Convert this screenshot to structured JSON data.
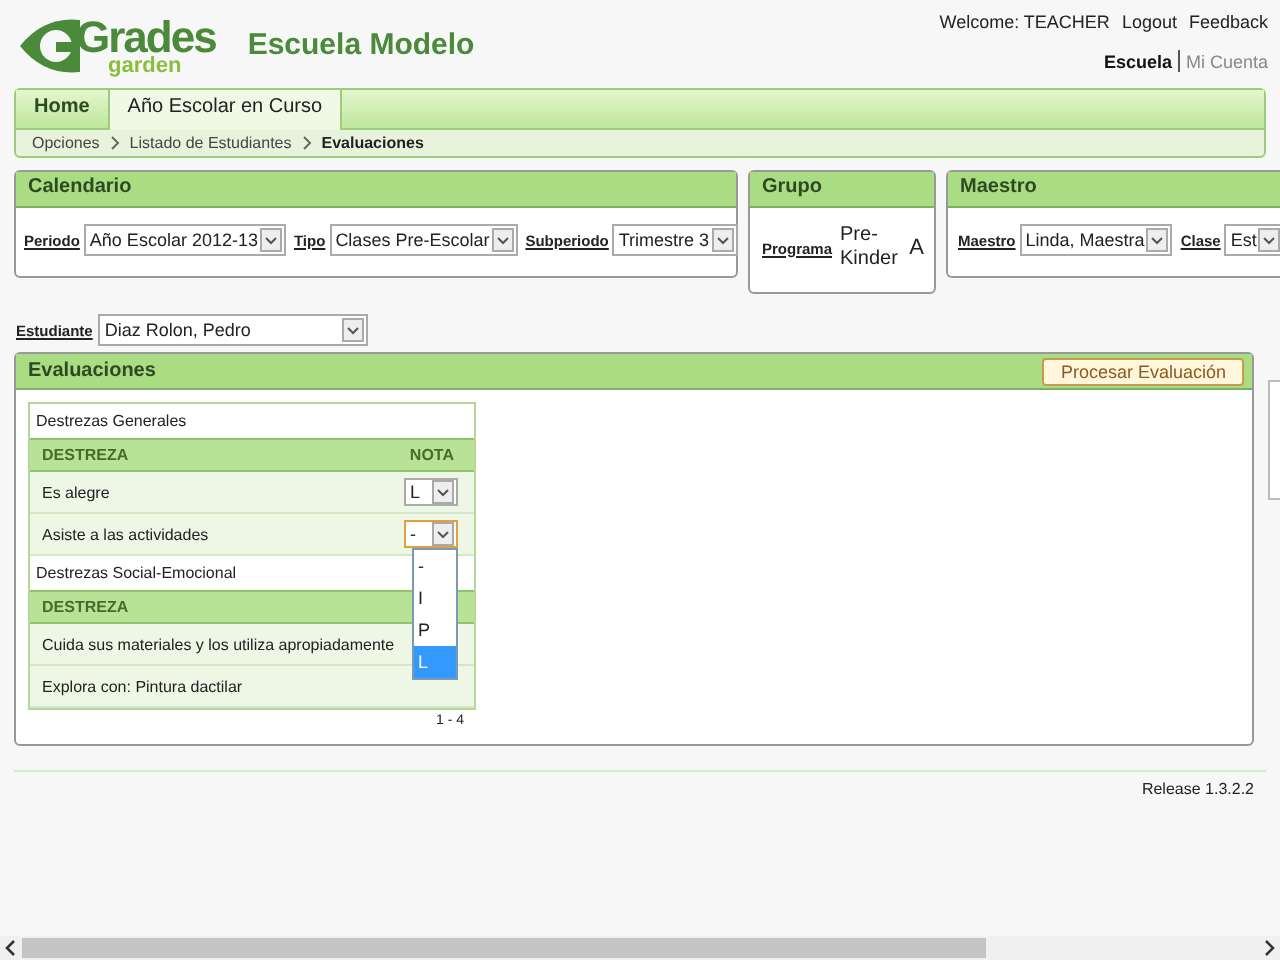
{
  "logo": {
    "word": "Grades",
    "sub": "garden"
  },
  "school": "Escuela Modelo",
  "user_links": [
    "Welcome: TEACHER",
    "Logout",
    "Feedback"
  ],
  "context": [
    {
      "label": "Escuela",
      "selected": true
    },
    {
      "label": "Mi Cuenta",
      "selected": false
    }
  ],
  "tabs": [
    {
      "label": "Home",
      "selected": false
    },
    {
      "label": "Año Escolar en Curso",
      "selected": true
    }
  ],
  "breadcrumb": [
    "Opciones",
    "Listado de Estudiantes",
    "Evaluaciones"
  ],
  "panels": [
    {
      "title": "Calendario",
      "fields": [
        {
          "label": "Periodo",
          "value": "Año Escolar 2012-13"
        },
        {
          "label": "Tipo",
          "value": "Clases Pre-Escolar"
        },
        {
          "label": "Subperiodo",
          "value": "Trimestre 3"
        }
      ]
    },
    {
      "title": "Grupo",
      "program": {
        "label": "Programa",
        "value": "Pre-Kinder",
        "group": "A"
      }
    },
    {
      "title": "Maestro",
      "fields": [
        {
          "label": "Maestro",
          "value": "Linda, Maestra"
        },
        {
          "label": "Clase",
          "value": "Est"
        }
      ]
    }
  ],
  "student": {
    "label": "Estudiante",
    "value": "Diaz Rolon, Pedro"
  },
  "evaluations": {
    "title": "Evaluaciones",
    "button": "Procesar Evaluación",
    "sections": [
      {
        "name": "Destrezas Generales",
        "col_skill": "DESTREZA",
        "col_grade": "NOTA",
        "rows": [
          {
            "skill": "Es alegre",
            "grade": "L",
            "focused": false
          },
          {
            "skill": "Asiste a las actividades",
            "grade": "-",
            "focused": true
          }
        ]
      },
      {
        "name": "Destrezas Social-Emocional",
        "col_skill": "DESTREZA",
        "rows": [
          {
            "skill": "Cuida sus materiales y los utiliza apropiadamente"
          },
          {
            "skill": "Explora con: Pintura dactilar"
          }
        ]
      }
    ],
    "dropdown": [
      {
        "label": "-",
        "selected": false
      },
      {
        "label": "I",
        "selected": false
      },
      {
        "label": "P",
        "selected": false
      },
      {
        "label": "L",
        "selected": true
      }
    ],
    "pager": "1 - 4"
  },
  "release": "Release 1.3.2.2"
}
